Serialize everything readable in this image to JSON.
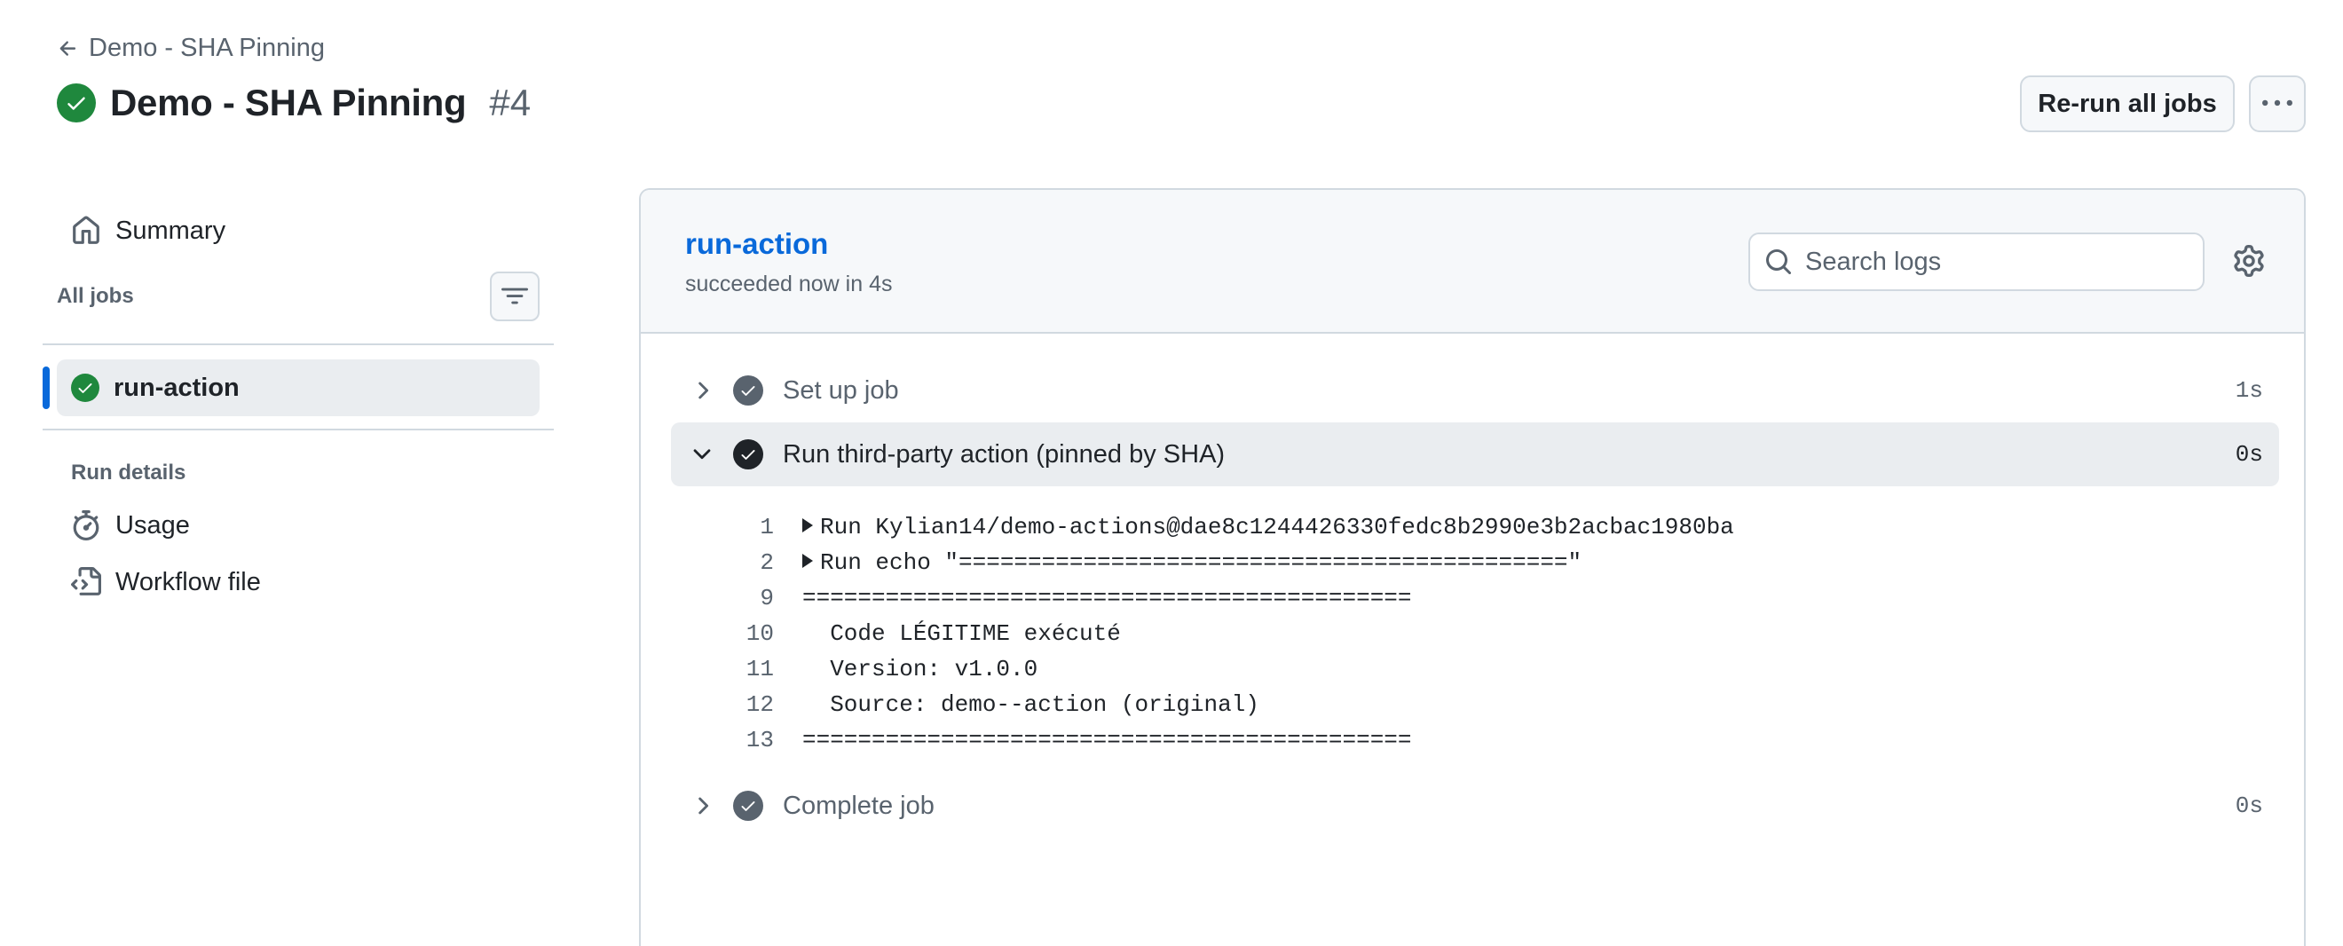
{
  "header": {
    "back_label": "Demo - SHA Pinning",
    "title": "Demo - SHA Pinning",
    "run_number": "#4",
    "rerun_label": "Re-run all jobs"
  },
  "sidebar": {
    "summary_label": "Summary",
    "all_jobs_label": "All jobs",
    "jobs": [
      {
        "label": "run-action",
        "status": "success"
      }
    ],
    "run_details_label": "Run details",
    "usage_label": "Usage",
    "workflow_file_label": "Workflow file"
  },
  "job_panel": {
    "title": "run-action",
    "subtitle": "succeeded now in 4s",
    "search_placeholder": "Search logs",
    "steps": [
      {
        "name": "Set up job",
        "duration": "1s",
        "expanded": false
      },
      {
        "name": "Run third-party action (pinned by SHA)",
        "duration": "0s",
        "expanded": true
      },
      {
        "name": "Complete job",
        "duration": "0s",
        "expanded": false
      }
    ],
    "log_lines": [
      {
        "num": "1",
        "text": "Run Kylian14/demo-actions@dae8c1244426330fedc8b2990e3b2acbac1980ba",
        "collapsible": true
      },
      {
        "num": "2",
        "text": "Run echo \"============================================\"",
        "collapsible": true
      },
      {
        "num": "9",
        "text": "============================================",
        "collapsible": false
      },
      {
        "num": "10",
        "text": "  Code LÉGITIME exécuté",
        "collapsible": false
      },
      {
        "num": "11",
        "text": "  Version: v1.0.0",
        "collapsible": false
      },
      {
        "num": "12",
        "text": "  Source: demo--action (original)",
        "collapsible": false
      },
      {
        "num": "13",
        "text": "============================================",
        "collapsible": false
      }
    ]
  },
  "colors": {
    "success": "#1f883d",
    "link": "#0969da",
    "muted": "#59636e",
    "border": "#d1d9e0"
  }
}
